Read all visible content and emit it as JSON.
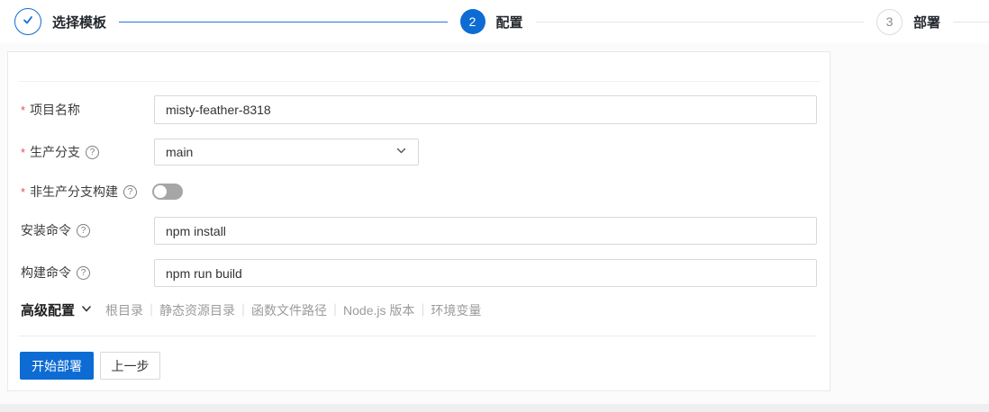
{
  "colors": {
    "accent": "#0d6cd3",
    "required": "#e34d59",
    "toggle_off": "#a6a6a6",
    "pending_gray": "#8a8a8a"
  },
  "stepper": {
    "steps": [
      {
        "label": "选择模板",
        "status": "done"
      },
      {
        "number": "2",
        "label": "配置",
        "status": "active"
      },
      {
        "number": "3",
        "label": "部署",
        "status": "pending"
      }
    ]
  },
  "form": {
    "required_marker": "*",
    "help_glyph": "?",
    "fields": [
      {
        "label": "项目名称",
        "required": true,
        "type": "text",
        "value": "misty-feather-8318"
      },
      {
        "label": "生产分支",
        "required": true,
        "help": true,
        "type": "select",
        "value": "main"
      },
      {
        "label": "非生产分支构建",
        "required": true,
        "help": true,
        "type": "toggle",
        "state": "off"
      },
      {
        "label": "安装命令",
        "help": true,
        "type": "text",
        "value": "npm install"
      },
      {
        "label": "构建命令",
        "help": true,
        "type": "text",
        "value": "npm run build"
      }
    ],
    "advanced": {
      "title": "高级配置",
      "separator": "｜",
      "links": [
        "根目录",
        "静态资源目录",
        "函数文件路径",
        "Node.js 版本",
        "环境变量"
      ]
    },
    "actions": {
      "deploy": "开始部署",
      "back": "上一步"
    }
  }
}
